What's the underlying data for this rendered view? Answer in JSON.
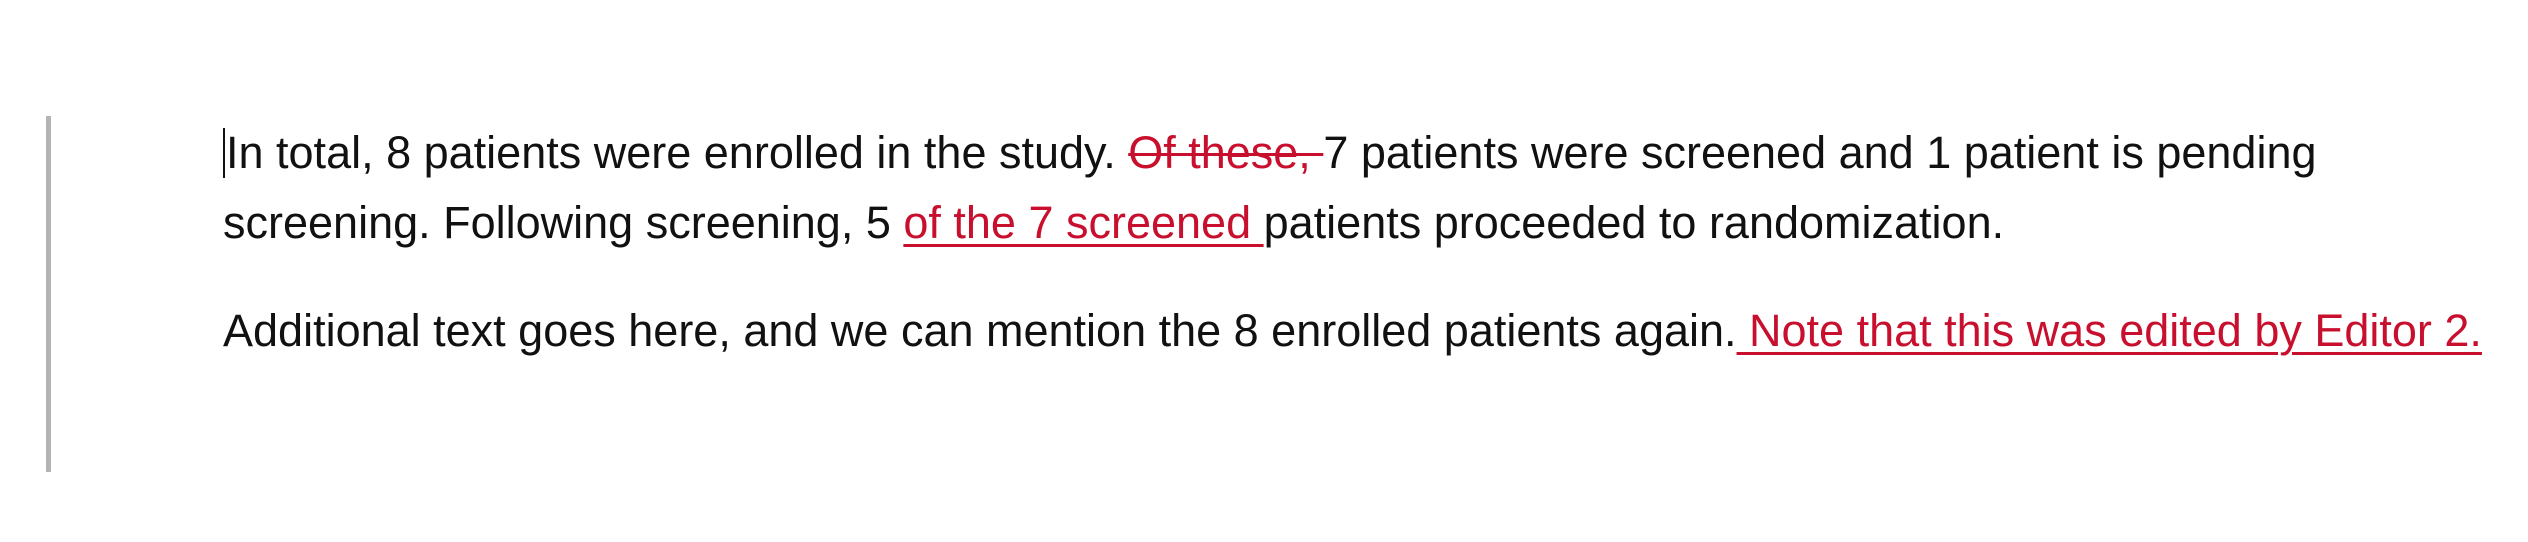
{
  "document": {
    "paragraph_1": {
      "text_1": "In total, 8 patients were enrolled in the study.  ",
      "deleted_1": "Of these, ",
      "text_2": "7 patients were screened and 1 patient is pending screening.  Following screening, 5 ",
      "inserted_1": "of the 7 screened ",
      "text_3": "patients proceeded to randomization."
    },
    "paragraph_2": {
      "text_1": "Additional text goes here, and we can mention the 8 enrolled patients again.",
      "inserted_1": "  Note that this was edited by Editor 2."
    }
  },
  "colors": {
    "tracked_change": "#c8102e",
    "change_bar": "#b3b3b3",
    "body_text": "#111111"
  }
}
